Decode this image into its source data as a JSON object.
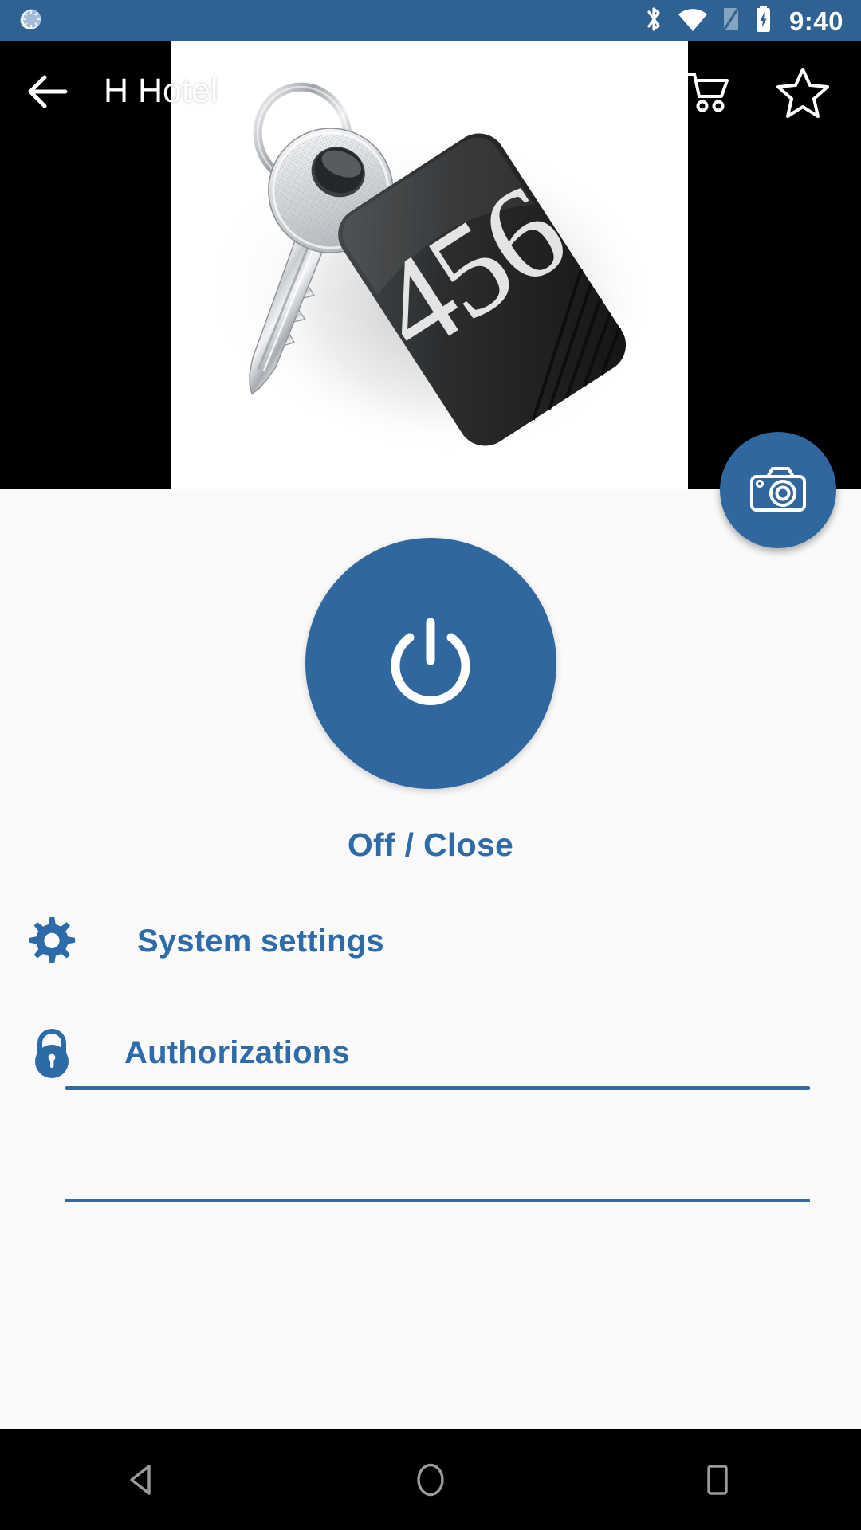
{
  "status_bar": {
    "background_color": "#2f6193",
    "clock": "9:40",
    "left_icons": [
      {
        "name": "sun-moon-icon",
        "label": "brightness"
      }
    ],
    "right_icons": [
      {
        "name": "bluetooth-icon",
        "label": "Bluetooth"
      },
      {
        "name": "wifi-icon",
        "label": "Wi-Fi"
      },
      {
        "name": "sim-card-icon",
        "label": "No SIM"
      },
      {
        "name": "battery-charging-icon",
        "label": "Battery charging"
      }
    ]
  },
  "app_bar": {
    "background_color": "#000000",
    "back_icon": "arrow-back-icon",
    "title": "H             Hotel",
    "actions": [
      {
        "name": "cart-icon",
        "label": "Cart"
      },
      {
        "name": "star-icon",
        "label": "Favorite"
      }
    ]
  },
  "hero": {
    "name": "hotel-key-photo",
    "alt": "Hotel room key with black keychain fob",
    "fob_number": "456",
    "background_color": "#ffffff"
  },
  "fab": {
    "name": "camera-fab",
    "icon": "camera-icon",
    "color": "#31679f"
  },
  "main": {
    "background_color": "#fafafa",
    "power_button": {
      "name": "power-toggle-button",
      "icon": "power-icon",
      "color": "#31679f"
    },
    "power_label": "Off / Close",
    "accent_color": "#2e6ba8",
    "menu_items": [
      {
        "id": "system-settings",
        "label": "System settings",
        "icon": "gear-icon"
      },
      {
        "id": "authorizations",
        "label": "Authorizations",
        "icon": "lock-icon"
      }
    ]
  },
  "nav_bar": {
    "background_color": "#000000",
    "keys": [
      {
        "name": "nav-back-icon",
        "label": "Back"
      },
      {
        "name": "nav-home-icon",
        "label": "Home"
      },
      {
        "name": "nav-recents-icon",
        "label": "Recents"
      }
    ]
  }
}
